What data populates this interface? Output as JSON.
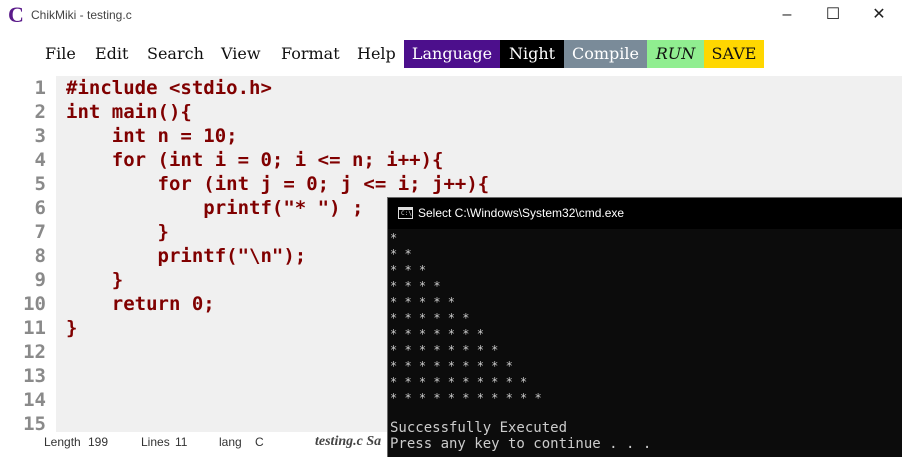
{
  "window": {
    "logo": "C",
    "title": "ChikMiki - testing.c",
    "minimize": "–",
    "maximize": "☐",
    "close": "✕"
  },
  "menu": {
    "items": [
      "File",
      "Edit",
      "Search",
      "View",
      "Format",
      "Help"
    ],
    "buttons": {
      "language": "Language",
      "night": "Night",
      "compile": "Compile",
      "run": "RUN",
      "save": "SAVE"
    },
    "button_colors": {
      "language": "#4c0f8c",
      "night": "#000000",
      "compile": "#7a8b99",
      "run": "#90ee90",
      "save": "#ffd700"
    }
  },
  "editor": {
    "line_numbers": [
      "1",
      "2",
      "3",
      "4",
      "5",
      "6",
      "7",
      "8",
      "9",
      "10",
      "11",
      "12",
      "13",
      "14",
      "15"
    ],
    "code": [
      "#include <stdio.h>",
      "int main(){",
      "    int n = 10;",
      "    for (int i = 0; i <= n; i++){",
      "        for (int j = 0; j <= i; j++){",
      "            printf(\"* \") ;",
      "        }",
      "        printf(\"\\n\");",
      "    }",
      "    return 0;",
      "}"
    ],
    "code_color": "#800000"
  },
  "status": {
    "length_label": "Length",
    "length_value": "199",
    "lines_label": "Lines",
    "lines_value": "11",
    "lang_label": "lang",
    "lang_value": "C",
    "file": "testing.c Sa"
  },
  "console": {
    "title": "Select C:\\Windows\\System32\\cmd.exe",
    "output": [
      "*",
      "* *",
      "* * *",
      "* * * *",
      "* * * * *",
      "* * * * * *",
      "* * * * * * *",
      "* * * * * * * *",
      "* * * * * * * * *",
      "* * * * * * * * * *",
      "* * * * * * * * * * *"
    ],
    "message1": "Successfully Executed",
    "message2": "Press any key to continue . . ."
  }
}
